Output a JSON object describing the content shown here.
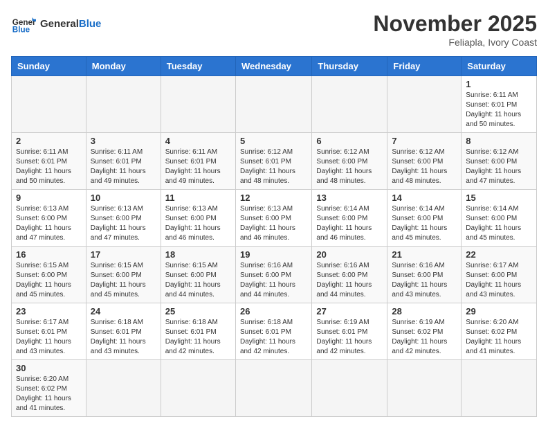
{
  "header": {
    "logo_general": "General",
    "logo_blue": "Blue",
    "month": "November 2025",
    "location": "Feliapla, Ivory Coast"
  },
  "weekdays": [
    "Sunday",
    "Monday",
    "Tuesday",
    "Wednesday",
    "Thursday",
    "Friday",
    "Saturday"
  ],
  "weeks": [
    [
      {
        "day": "",
        "info": ""
      },
      {
        "day": "",
        "info": ""
      },
      {
        "day": "",
        "info": ""
      },
      {
        "day": "",
        "info": ""
      },
      {
        "day": "",
        "info": ""
      },
      {
        "day": "",
        "info": ""
      },
      {
        "day": "1",
        "info": "Sunrise: 6:11 AM\nSunset: 6:01 PM\nDaylight: 11 hours\nand 50 minutes."
      }
    ],
    [
      {
        "day": "2",
        "info": "Sunrise: 6:11 AM\nSunset: 6:01 PM\nDaylight: 11 hours\nand 50 minutes."
      },
      {
        "day": "3",
        "info": "Sunrise: 6:11 AM\nSunset: 6:01 PM\nDaylight: 11 hours\nand 49 minutes."
      },
      {
        "day": "4",
        "info": "Sunrise: 6:11 AM\nSunset: 6:01 PM\nDaylight: 11 hours\nand 49 minutes."
      },
      {
        "day": "5",
        "info": "Sunrise: 6:12 AM\nSunset: 6:01 PM\nDaylight: 11 hours\nand 48 minutes."
      },
      {
        "day": "6",
        "info": "Sunrise: 6:12 AM\nSunset: 6:00 PM\nDaylight: 11 hours\nand 48 minutes."
      },
      {
        "day": "7",
        "info": "Sunrise: 6:12 AM\nSunset: 6:00 PM\nDaylight: 11 hours\nand 48 minutes."
      },
      {
        "day": "8",
        "info": "Sunrise: 6:12 AM\nSunset: 6:00 PM\nDaylight: 11 hours\nand 47 minutes."
      }
    ],
    [
      {
        "day": "9",
        "info": "Sunrise: 6:13 AM\nSunset: 6:00 PM\nDaylight: 11 hours\nand 47 minutes."
      },
      {
        "day": "10",
        "info": "Sunrise: 6:13 AM\nSunset: 6:00 PM\nDaylight: 11 hours\nand 47 minutes."
      },
      {
        "day": "11",
        "info": "Sunrise: 6:13 AM\nSunset: 6:00 PM\nDaylight: 11 hours\nand 46 minutes."
      },
      {
        "day": "12",
        "info": "Sunrise: 6:13 AM\nSunset: 6:00 PM\nDaylight: 11 hours\nand 46 minutes."
      },
      {
        "day": "13",
        "info": "Sunrise: 6:14 AM\nSunset: 6:00 PM\nDaylight: 11 hours\nand 46 minutes."
      },
      {
        "day": "14",
        "info": "Sunrise: 6:14 AM\nSunset: 6:00 PM\nDaylight: 11 hours\nand 45 minutes."
      },
      {
        "day": "15",
        "info": "Sunrise: 6:14 AM\nSunset: 6:00 PM\nDaylight: 11 hours\nand 45 minutes."
      }
    ],
    [
      {
        "day": "16",
        "info": "Sunrise: 6:15 AM\nSunset: 6:00 PM\nDaylight: 11 hours\nand 45 minutes."
      },
      {
        "day": "17",
        "info": "Sunrise: 6:15 AM\nSunset: 6:00 PM\nDaylight: 11 hours\nand 45 minutes."
      },
      {
        "day": "18",
        "info": "Sunrise: 6:15 AM\nSunset: 6:00 PM\nDaylight: 11 hours\nand 44 minutes."
      },
      {
        "day": "19",
        "info": "Sunrise: 6:16 AM\nSunset: 6:00 PM\nDaylight: 11 hours\nand 44 minutes."
      },
      {
        "day": "20",
        "info": "Sunrise: 6:16 AM\nSunset: 6:00 PM\nDaylight: 11 hours\nand 44 minutes."
      },
      {
        "day": "21",
        "info": "Sunrise: 6:16 AM\nSunset: 6:00 PM\nDaylight: 11 hours\nand 43 minutes."
      },
      {
        "day": "22",
        "info": "Sunrise: 6:17 AM\nSunset: 6:00 PM\nDaylight: 11 hours\nand 43 minutes."
      }
    ],
    [
      {
        "day": "23",
        "info": "Sunrise: 6:17 AM\nSunset: 6:01 PM\nDaylight: 11 hours\nand 43 minutes."
      },
      {
        "day": "24",
        "info": "Sunrise: 6:18 AM\nSunset: 6:01 PM\nDaylight: 11 hours\nand 43 minutes."
      },
      {
        "day": "25",
        "info": "Sunrise: 6:18 AM\nSunset: 6:01 PM\nDaylight: 11 hours\nand 42 minutes."
      },
      {
        "day": "26",
        "info": "Sunrise: 6:18 AM\nSunset: 6:01 PM\nDaylight: 11 hours\nand 42 minutes."
      },
      {
        "day": "27",
        "info": "Sunrise: 6:19 AM\nSunset: 6:01 PM\nDaylight: 11 hours\nand 42 minutes."
      },
      {
        "day": "28",
        "info": "Sunrise: 6:19 AM\nSunset: 6:02 PM\nDaylight: 11 hours\nand 42 minutes."
      },
      {
        "day": "29",
        "info": "Sunrise: 6:20 AM\nSunset: 6:02 PM\nDaylight: 11 hours\nand 41 minutes."
      }
    ],
    [
      {
        "day": "30",
        "info": "Sunrise: 6:20 AM\nSunset: 6:02 PM\nDaylight: 11 hours\nand 41 minutes."
      },
      {
        "day": "",
        "info": ""
      },
      {
        "day": "",
        "info": ""
      },
      {
        "day": "",
        "info": ""
      },
      {
        "day": "",
        "info": ""
      },
      {
        "day": "",
        "info": ""
      },
      {
        "day": "",
        "info": ""
      }
    ]
  ]
}
